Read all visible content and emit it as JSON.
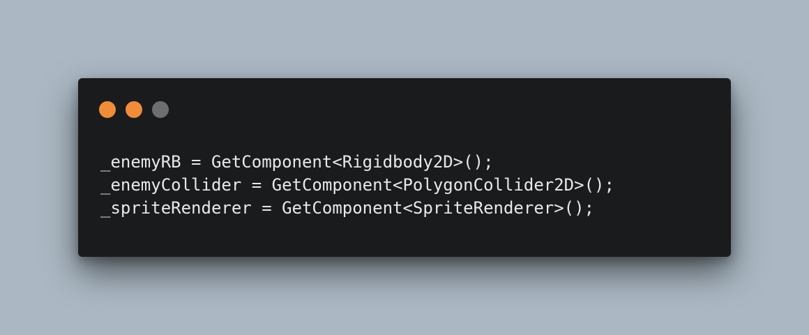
{
  "window": {
    "background": "#1a1b1d",
    "controls": [
      {
        "name": "close",
        "color": "#f28c38"
      },
      {
        "name": "minimize",
        "color": "#f28c38"
      },
      {
        "name": "maximize",
        "color": "#6c6f72"
      }
    ]
  },
  "code": {
    "language": "C#",
    "lines": [
      "_enemyRB = GetComponent<Rigidbody2D>();",
      "_enemyCollider = GetComponent<PolygonCollider2D>();",
      "_spriteRenderer = GetComponent<SpriteRenderer>();"
    ]
  },
  "page": {
    "background": "#abb8c3"
  }
}
